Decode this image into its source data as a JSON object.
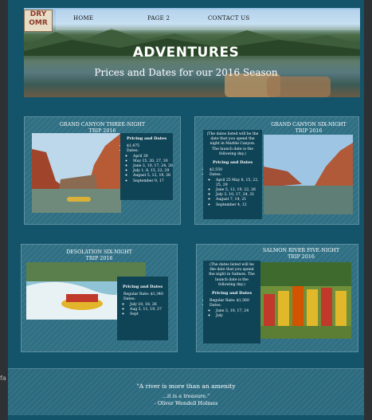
{
  "logo": {
    "line1": "DRY",
    "line2": "OMR"
  },
  "nav": {
    "home": "HOME",
    "page2": "PAGE 2",
    "contact": "CONTACT US"
  },
  "hero": {
    "title": "ADVENTURES",
    "subtitle": "Prices and Dates for our 2016 Season"
  },
  "cards": [
    {
      "title_l1": "GRAND CANYON THREE-NIGHT",
      "title_l2": "TRIP 2016",
      "panel_heading": "Pricing and Dates",
      "price": "$1,475",
      "dates_label": "Dates:",
      "dates": [
        "April 30",
        "May 15, 20, 27, 30",
        "June 3, 10, 17, 24, 28",
        "July 1, 8, 15, 22, 29",
        "August 5, 12, 19, 26",
        "September 9, 17"
      ]
    },
    {
      "title_l1": "GRAND CANYON SIX-NIGHT",
      "title_l2": "TRIP 2016",
      "note": "(The dates listed will be the date that you spend the night in Marble Canyon. The launch date is the following day.)",
      "panel_heading": "Pricing and Dates",
      "price": "$2,550",
      "dates_label": "Dates:",
      "dates": [
        "April 25 May 8, 15, 22, 25, 29",
        "June 5, 12, 19, 22, 26",
        "July 3, 10, 17, 24, 31",
        "August 7, 14, 21",
        "September 4, 12"
      ]
    },
    {
      "title_l1": "DESOLATION SIX-NIGHT",
      "title_l2": "TRIP 2016",
      "panel_heading": "Pricing and Dates",
      "price": "Regular Rate: $1,340",
      "dates_label": "Dates:",
      "dates": [
        "July 10, 18, 26",
        "Aug 3, 11, 19, 27",
        "Sept"
      ]
    },
    {
      "title_l1": "SALMON RIVER FIVE-NIGHT",
      "title_l2": "TRIP 2016",
      "note": "(The dates listed will be the date that you spend the night in Salmon. The launch date is the following day.)",
      "panel_heading": "Pricing and Dates",
      "price": "Regular Rate: $1,560",
      "dates_label": "Dates:",
      "dates": [
        "June 3, 10, 17, 24",
        "July"
      ]
    }
  ],
  "quote": {
    "line1": "\"A river is more than an amenity",
    "line2": "...it is a treasure.\"",
    "author": "- Oliver Wendell Holmes"
  },
  "edge": {
    "left_char": "fa"
  },
  "colors": {
    "page_bg": "#13546a",
    "card_bg": "#2f6f84",
    "panel_bg": "#0f4457",
    "text": "#ffffff"
  }
}
